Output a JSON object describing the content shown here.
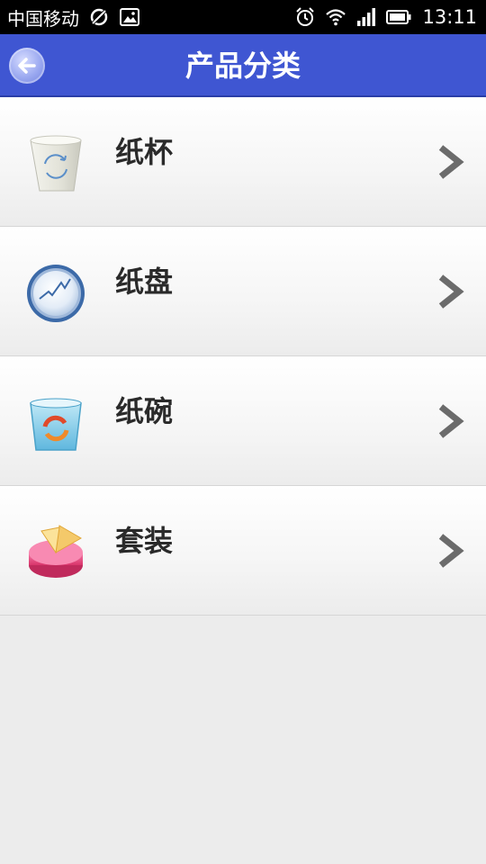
{
  "status_bar": {
    "carrier": "中国移动",
    "time": "13:11"
  },
  "header": {
    "title": "产品分类"
  },
  "categories": [
    {
      "label": "纸杯",
      "icon": "paper-cup-icon"
    },
    {
      "label": "纸盘",
      "icon": "paper-plate-icon"
    },
    {
      "label": "纸碗",
      "icon": "paper-bowl-icon"
    },
    {
      "label": "套装",
      "icon": "set-icon"
    }
  ],
  "colors": {
    "title_bar": "#3f56d2",
    "status_bar": "#000000",
    "background": "#ececec",
    "label": "#2a2a2a",
    "chevron": "#6b6b6b"
  }
}
